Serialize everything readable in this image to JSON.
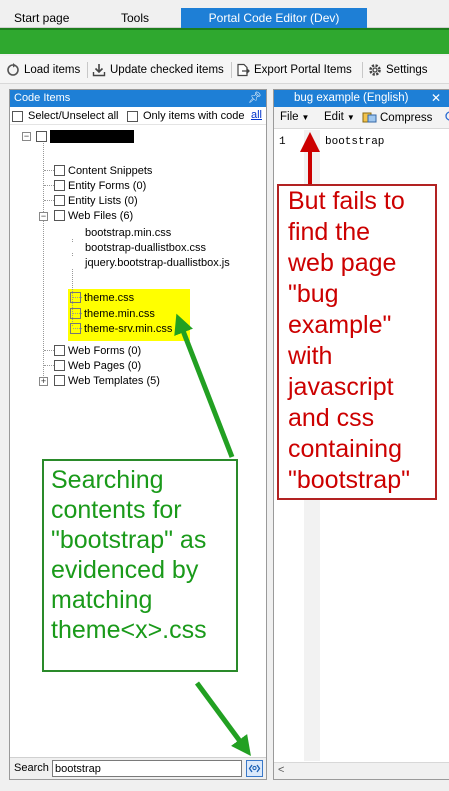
{
  "tabs": [
    {
      "label": "Start page",
      "active": false
    },
    {
      "label": "Tools",
      "active": false
    },
    {
      "label": "Portal Code Editor (Dev)",
      "active": true
    }
  ],
  "toolbar": {
    "load_items": "Load items",
    "update_checked": "Update checked items",
    "export_portal": "Export Portal Items",
    "settings": "Settings"
  },
  "code_items": {
    "header": "Code Items",
    "pin_icon": "pin-icon",
    "select_all_label": "Select/Unselect all",
    "only_code_label": "Only items with code",
    "all_link": "all",
    "tree": {
      "content_snippets": "Content Snippets",
      "entity_forms": "Entity Forms (0)",
      "entity_lists": "Entity Lists (0)",
      "web_files": "Web Files (6)",
      "files": [
        "bootstrap.min.css",
        "bootstrap-duallistbox.css",
        "jquery.bootstrap-duallistbox.js"
      ],
      "matched_files": [
        "theme.css",
        "theme.min.css",
        "theme-srv.min.css"
      ],
      "web_forms": "Web Forms (0)",
      "web_pages": "Web Pages (0)",
      "web_templates": "Web Templates (5)"
    },
    "search_label": "Search",
    "search_value": "bootstrap"
  },
  "editor": {
    "tab_title": "bug example (English)",
    "file_menu": "File",
    "edit_menu": "Edit",
    "compress": "Compress",
    "line_number": "1",
    "code_line": "bootstrap"
  },
  "annotations": {
    "red_lines": [
      "But fails to",
      "find the",
      "web page",
      "\"bug",
      "example\"",
      "with",
      "javascript",
      "and css",
      "containing",
      "\"bootstrap\""
    ],
    "green_lines": [
      "Searching",
      "contents for",
      "\"bootstrap\" as",
      "evidenced by",
      "matching",
      "theme<x>.css"
    ],
    "red_color": "#cc0000",
    "green_color": "#1a9a1a"
  },
  "colors": {
    "accent_blue": "#1e7fd6",
    "green_bar": "#2fa82f",
    "highlight": "#ffff00"
  }
}
